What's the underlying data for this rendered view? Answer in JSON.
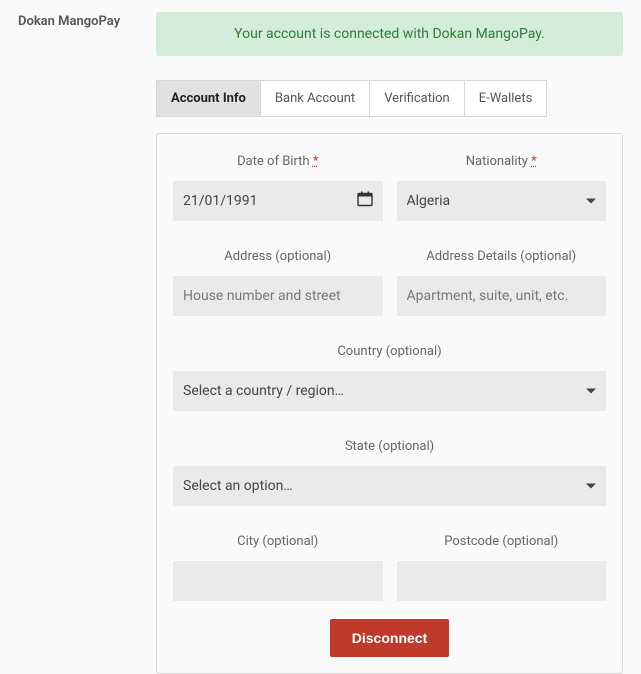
{
  "side_title": "Dokan MangoPay",
  "alert_message": "Your account is connected with Dokan MangoPay.",
  "tabs": {
    "account_info": "Account Info",
    "bank_account": "Bank Account",
    "verification": "Verification",
    "ewallets": "E-Wallets"
  },
  "form": {
    "dob_label": "Date of Birth",
    "dob_value": "21/01/1991",
    "nationality_label": "Nationality",
    "nationality_value": "Algeria",
    "address_label": "Address (optional)",
    "address_placeholder": "House number and street",
    "address_details_label": "Address Details (optional)",
    "address_details_placeholder": "Apartment, suite, unit, etc.",
    "country_label": "Country (optional)",
    "country_placeholder": "Select a country / region…",
    "state_label": "State (optional)",
    "state_placeholder": "Select an option…",
    "city_label": "City (optional)",
    "postcode_label": "Postcode (optional)",
    "required_mark": "*"
  },
  "disconnect_label": "Disconnect"
}
